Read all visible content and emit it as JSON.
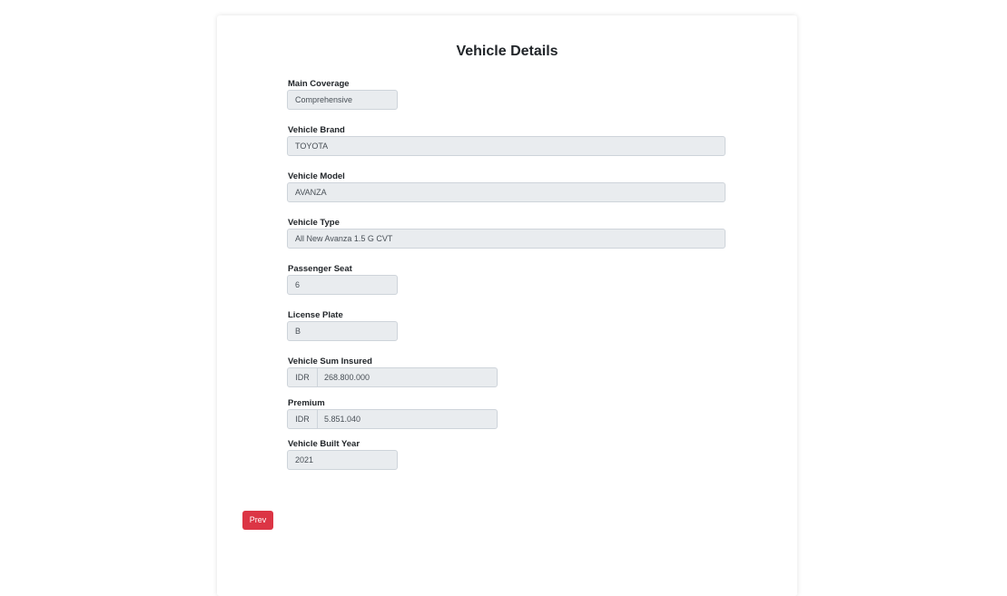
{
  "page": {
    "title": "Vehicle Details"
  },
  "fields": {
    "main_coverage": {
      "label": "Main Coverage",
      "value": "Comprehensive"
    },
    "vehicle_brand": {
      "label": "Vehicle Brand",
      "value": "TOYOTA"
    },
    "vehicle_model": {
      "label": "Vehicle Model",
      "value": "AVANZA"
    },
    "vehicle_type": {
      "label": "Vehicle Type",
      "value": "All New Avanza 1.5 G CVT"
    },
    "passenger_seat": {
      "label": "Passenger Seat",
      "value": "6"
    },
    "license_plate": {
      "label": "License Plate",
      "value": "B"
    },
    "sum_insured": {
      "label": "Vehicle Sum Insured",
      "prefix": "IDR",
      "value": "268.800.000"
    },
    "premium": {
      "label": "Premium",
      "prefix": "IDR",
      "value": "5.851.040"
    },
    "built_year": {
      "label": "Vehicle Built Year",
      "value": "2021"
    }
  },
  "actions": {
    "prev_label": "Prev"
  },
  "colors": {
    "prev_button": "#dc3545",
    "field_background": "#e9ecef"
  }
}
